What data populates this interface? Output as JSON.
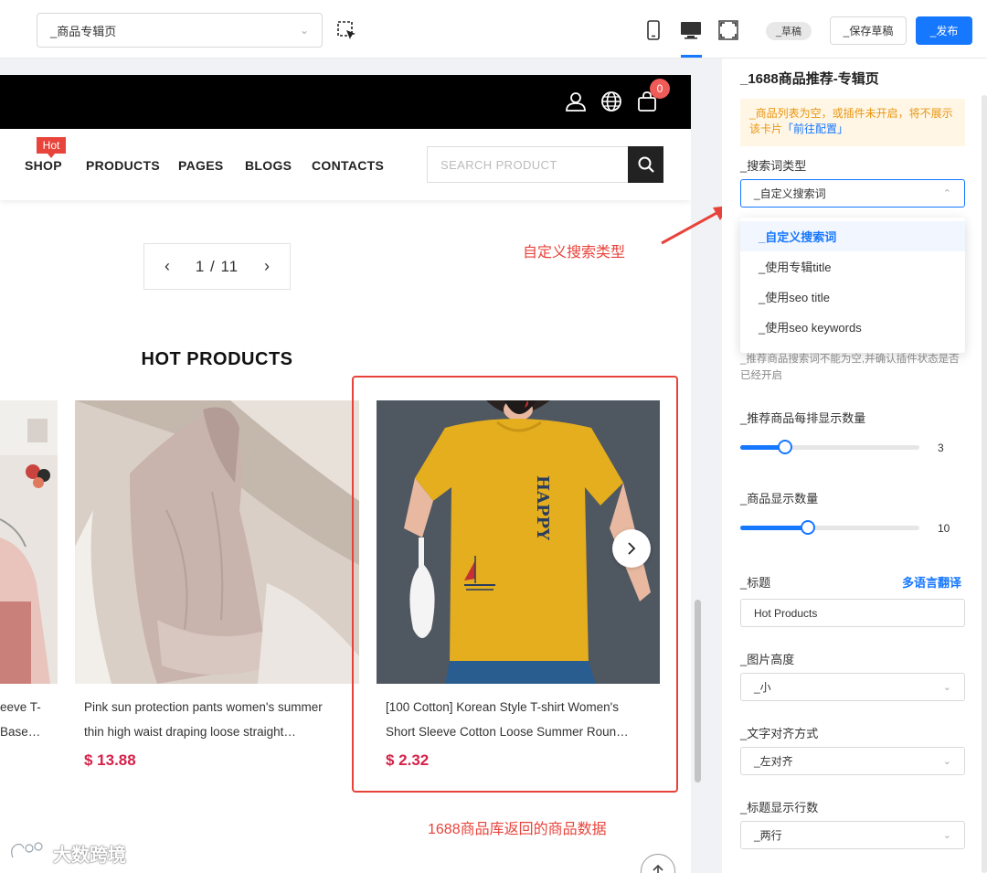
{
  "toolbar": {
    "page_select_value": "_商品专辑页",
    "draft_badge": "_草稿",
    "save_draft_label": "_保存草稿",
    "publish_label": "_发布"
  },
  "store": {
    "cart_count": "0",
    "hot_tag": "Hot",
    "nav": [
      "SHOP",
      "PRODUCTS",
      "PAGES",
      "BLOGS",
      "CONTACTS"
    ],
    "search_placeholder": "SEARCH PRODUCT",
    "pager": {
      "prev": "‹",
      "text": "1 / 11",
      "next": "›"
    },
    "section_title": "HOT PRODUCTS",
    "products": [
      {
        "line1": "eeve T-",
        "line2": "Base…",
        "price": ""
      },
      {
        "line1": "Pink sun protection pants women's summer",
        "line2": "thin high waist draping loose straight…",
        "price": "$ 13.88"
      },
      {
        "line1": "[100 Cotton] Korean Style T-shirt Women's",
        "line2": "Short Sleeve Cotton Loose Summer Roun…",
        "price": "$ 2.32"
      }
    ],
    "shirt_print": "HAPPY"
  },
  "annotations": {
    "search_type": "自定义搜索类型",
    "product_data": "1688商品库返回的商品数据",
    "watermark": "大数跨境"
  },
  "panel": {
    "title": "_1688商品推荐-专辑页",
    "warning_text": "_商品列表为空，或插件未开启，将不展示该卡片",
    "warning_link": "「前往配置」",
    "search_type_label": "_搜索词类型",
    "search_type_value": "_自定义搜索词",
    "search_type_options": [
      "_自定义搜索词",
      "_使用专辑title",
      "_使用seo title",
      "_使用seo keywords"
    ],
    "hint": "_推荐商品搜索词不能为空,并确认插件状态是否已经开启",
    "per_row_label": "_推荐商品每排显示数量",
    "per_row_value": "3",
    "count_label": "_商品显示数量",
    "count_value": "10",
    "title_label": "_标题",
    "translate_link": "多语言翻译",
    "title_value": "Hot Products",
    "img_height_label": "_图片高度",
    "img_height_value": "_小",
    "align_label": "_文字对齐方式",
    "align_value": "_左对齐",
    "lines_label": "_标题显示行数",
    "lines_value": "_两行"
  },
  "sliders": {
    "per_row_fraction": 0.25,
    "count_fraction": 0.375
  },
  "colors": {
    "accent": "#1677ff",
    "annotation": "#e8433b",
    "price": "#d5224a",
    "hot": "#e8443c"
  }
}
